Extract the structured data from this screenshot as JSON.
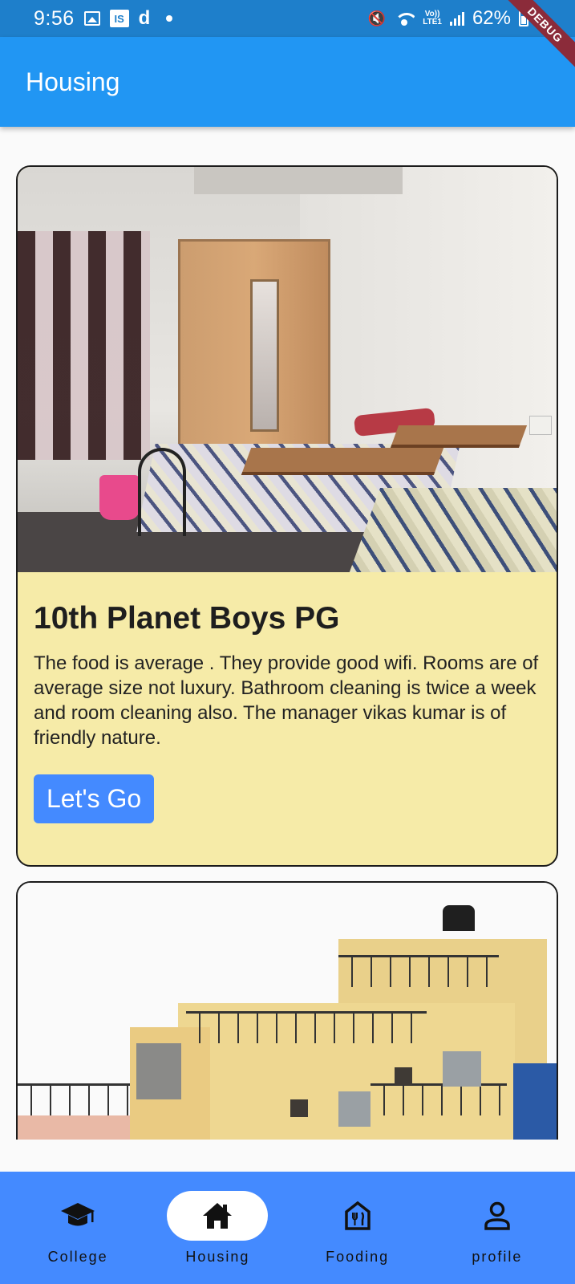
{
  "status_bar": {
    "time": "9:56",
    "battery": "62%",
    "network": "LTE1",
    "volte": "Vo))"
  },
  "debug_banner": "DEBUG",
  "app_bar": {
    "title": "Housing"
  },
  "listings": [
    {
      "title": "10th Planet Boys PG",
      "description": "The food is average . They provide good wifi. Rooms are of average size not luxury. Bathroom cleaning is twice a week and room cleaning  also. The manager vikas kumar is of friendly nature.",
      "button_label": "Let's Go",
      "photo": "hostel-room-photo"
    },
    {
      "photo": "building-exterior-photo"
    }
  ],
  "bottom_nav": {
    "items": [
      {
        "label": "College",
        "icon": "graduation-cap-icon",
        "active": false
      },
      {
        "label": "Housing",
        "icon": "home-icon",
        "active": true
      },
      {
        "label": "Fooding",
        "icon": "restaurant-icon",
        "active": false
      },
      {
        "label": "profile",
        "icon": "person-icon",
        "active": false
      }
    ]
  },
  "colors": {
    "status_bar": "#1e7fcb",
    "app_bar": "#2196f3",
    "card_body": "#f6eba8",
    "button": "#448aff",
    "bottom_nav": "#448aff"
  }
}
